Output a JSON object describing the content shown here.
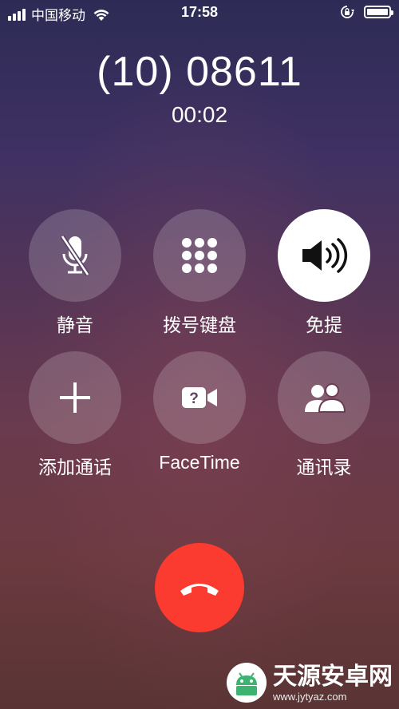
{
  "status_bar": {
    "carrier": "中国移动",
    "time": "17:58",
    "battery_level": 1.0
  },
  "call": {
    "number": "(10) 08611",
    "duration": "00:02"
  },
  "controls": [
    {
      "label": "静音",
      "icon": "mic-off-icon",
      "active": false
    },
    {
      "label": "拨号键盘",
      "icon": "keypad-icon",
      "active": false
    },
    {
      "label": "免提",
      "icon": "speaker-icon",
      "active": true
    },
    {
      "label": "添加通话",
      "icon": "plus-icon",
      "active": false
    },
    {
      "label": "FaceTime",
      "icon": "facetime-icon",
      "active": false
    },
    {
      "label": "通讯录",
      "icon": "contacts-icon",
      "active": false
    }
  ],
  "end_call": {
    "icon": "phone-hangup-icon",
    "color": "#fb3a30"
  },
  "watermark": {
    "title": "天源安卓网",
    "url": "www.jytyaz.com"
  }
}
